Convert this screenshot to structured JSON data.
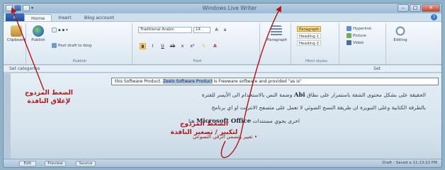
{
  "window": {
    "title": "Windows Live Writer",
    "file_tab": "≡",
    "tabs": [
      "Home",
      "Insert",
      "Blog account"
    ]
  },
  "ribbon": {
    "groups": [
      "Clipboard",
      "Publish",
      "Font",
      "Paragraph",
      "Html styles",
      "Insert",
      "Editing"
    ],
    "clipboard_btn": "Clipboard",
    "publish_btn": "Publish",
    "post_draft": "Post draft to blog",
    "font_name": "Traditional Arabic",
    "font_size": "14",
    "paragraph_btn": "Paragraph",
    "styles": [
      "Paragraph",
      "Heading 1",
      "Heading 2"
    ],
    "insert_items": [
      "Hyperlink",
      "Picture",
      "Video"
    ],
    "editing_btn": "Editing"
  },
  "ruler": {
    "label": "Set categories",
    "zoom": "Set"
  },
  "document": {
    "highlight_before": "this Software Product. ",
    "highlight_text": "Zeelo Software Product",
    "highlight_after": " is Freeware software and provided \"as is\"",
    "ar_line1": "الحقيقة على بشكل محتوى الشفة باستمرار على نطاق",
    "ar_line1_bold": "Abi",
    "ar_line1_tail": "وضمة النص بالاستخدام الى الأيسر للفترة",
    "ar_line2": "بالطرقة الكتابية وعلى التبويزة ان طريقة النسخ الضوئي لا تعمل على متصفح الانترنت او اي برنامج",
    "ar_line3": "اخرى يحوي مستندات",
    "ar_line3_bold": "Microsoft Office",
    "ar_line3_tail": "هنا",
    "bullet": "• تغيير وتسمي الرقي التسوعي"
  },
  "annotations": {
    "left": [
      "الضغط المزدوج",
      "لإغلاق النافذة"
    ],
    "center": [
      "الضغط المزدوج",
      "لتكبير / تصغير النافذة"
    ]
  },
  "status": {
    "buttons": [
      "Edit",
      "Preview",
      "Source"
    ],
    "right": "Draft - Saved a 11:13:22 PM"
  },
  "colors": {
    "annotation": "#b01616",
    "title_bar": "#9fbbd3",
    "file_tab": "#1d4e9b"
  }
}
